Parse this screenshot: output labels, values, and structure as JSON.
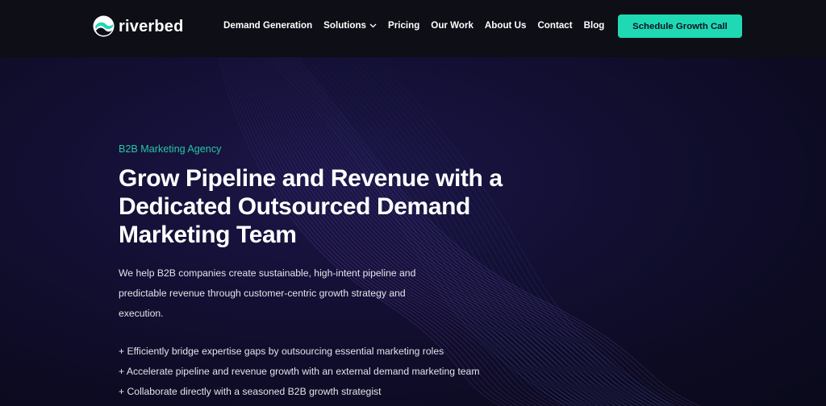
{
  "brand": {
    "name": "riverbed",
    "accent_color": "#1fd9b5",
    "logo_icon": "riverbed-logo-icon"
  },
  "nav": {
    "items": [
      {
        "label": "Demand Generation"
      },
      {
        "label": "Solutions",
        "icon": "chevron-down-icon"
      },
      {
        "label": "Pricing"
      },
      {
        "label": "Our Work"
      },
      {
        "label": "About Us"
      },
      {
        "label": "Contact"
      },
      {
        "label": "Blog"
      }
    ],
    "cta_label": "Schedule Growth Call"
  },
  "hero": {
    "eyebrow": "B2B Marketing Agency",
    "headline": "Grow Pipeline and Revenue with a Dedicated Outsourced Demand Marketing Team",
    "body": "We help B2B companies create sustainable, high-intent pipeline and predictable revenue through customer-centric growth strategy and execution.",
    "bullets": [
      "+ Efficiently bridge expertise gaps by outsourcing essential marketing roles",
      "+ Accelerate pipeline and revenue growth with an external demand marketing team",
      "+ Collaborate directly with a seasoned B2B growth strategist"
    ]
  },
  "colors": {
    "header_bg": "#0d0e16",
    "hero_bg": "#130f33",
    "eyebrow": "#24c7a3",
    "text": "#ffffff"
  }
}
